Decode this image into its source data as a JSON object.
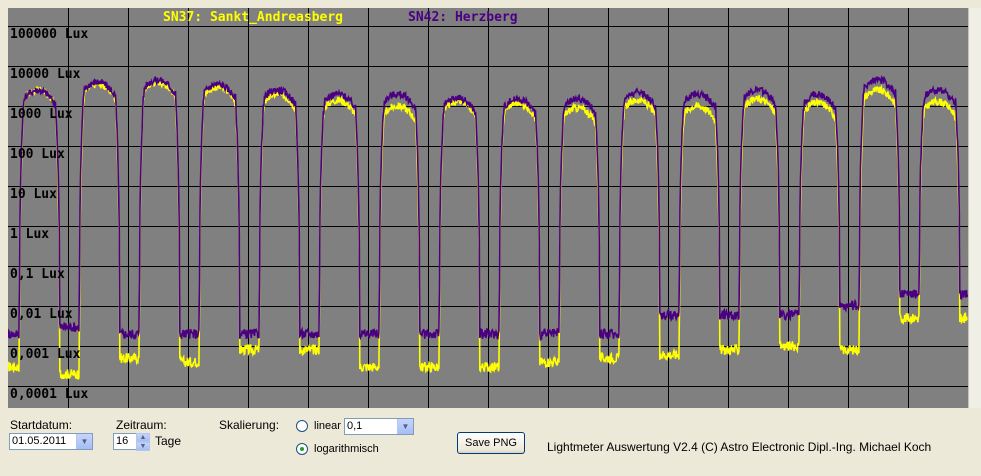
{
  "chart_data": {
    "type": "line",
    "y_scale": "log",
    "y_unit": "Lux",
    "ylim": [
      0.0001,
      100000
    ],
    "y_ticks": [
      {
        "value": 100000,
        "label": "100000 Lux"
      },
      {
        "value": 10000,
        "label": "10000 Lux"
      },
      {
        "value": 1000,
        "label": "1000 Lux"
      },
      {
        "value": 100,
        "label": "100 Lux"
      },
      {
        "value": 10,
        "label": "10 Lux"
      },
      {
        "value": 1,
        "label": "1 Lux"
      },
      {
        "value": 0.1,
        "label": "0,1 Lux"
      },
      {
        "value": 0.01,
        "label": "0,01 Lux"
      },
      {
        "value": 0.001,
        "label": "0,001 Lux"
      },
      {
        "value": 0.0001,
        "label": "0,0001 Lux"
      }
    ],
    "x_start": "2011-05-01",
    "x_days": 16,
    "grid": true,
    "legend_position": "top",
    "series": [
      {
        "name": "SN37: Sankt_Andreasberg",
        "color": "#ffff00",
        "day_peak_lux": [
          2500,
          3500,
          4000,
          3000,
          2000,
          1400,
          1000,
          1300,
          1200,
          900,
          1400,
          1000,
          1500,
          1200,
          2500,
          1300
        ],
        "night_lux": [
          0.0003,
          0.0002,
          0.0005,
          0.0004,
          0.0008,
          0.0008,
          0.0003,
          0.0003,
          0.0003,
          0.0004,
          0.0005,
          0.0006,
          0.0008,
          0.001,
          0.0008,
          0.005
        ]
      },
      {
        "name": "SN42: Herzberg",
        "color": "#4b0082",
        "day_peak_lux": [
          2500,
          4000,
          4500,
          3500,
          2500,
          2000,
          2000,
          1600,
          1500,
          1500,
          2200,
          2000,
          2500,
          2000,
          4500,
          2500
        ],
        "night_lux": [
          0.002,
          0.003,
          0.002,
          0.002,
          0.002,
          0.002,
          0.002,
          0.002,
          0.002,
          0.002,
          0.002,
          0.006,
          0.006,
          0.006,
          0.01,
          0.02
        ]
      }
    ]
  },
  "controls": {
    "startdatum_label": "Startdatum:",
    "startdatum_value": "01.05.2011",
    "zeitraum_label": "Zeitraum:",
    "zeitraum_value": "16",
    "zeitraum_unit": "Tage",
    "skalierung_label": "Skalierung:",
    "linear_label": "linear",
    "linear_value": "0,1",
    "log_label": "logarithmisch",
    "scale_selected": "logarithmisch",
    "save_label": "Save PNG",
    "footer": "Lightmeter Auswertung V2.4  (C) Astro Electronic Dipl.-Ing. Michael Koch"
  }
}
